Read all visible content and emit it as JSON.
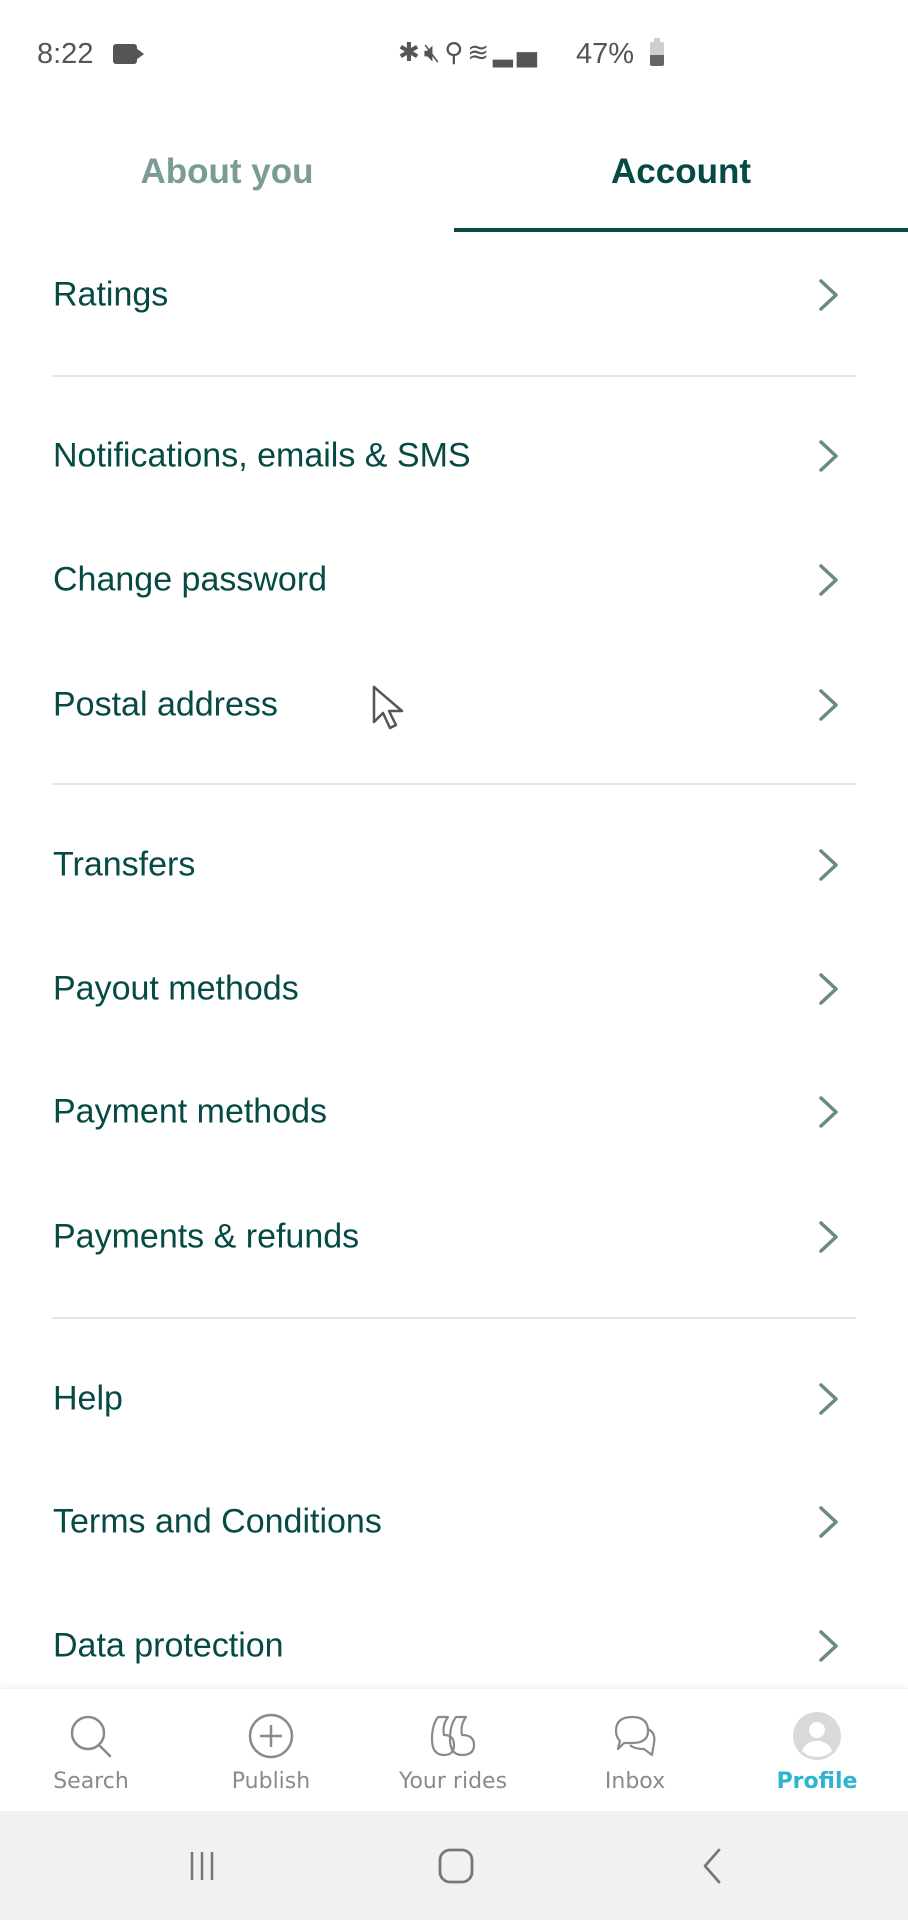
{
  "status_bar": {
    "time": "8:22",
    "recording_icon": "video-camera-icon",
    "indicator_icons": [
      "bluetooth-icon",
      "mute-vibrate-icon",
      "location-icon",
      "wifi-icon",
      "signal-icon"
    ],
    "battery_percent": "47%",
    "battery_level": 0.47
  },
  "tabs": [
    {
      "label": "About you",
      "active": false
    },
    {
      "label": "Account",
      "active": true
    }
  ],
  "colors": {
    "primary_text": "#054a44",
    "inactive_tab": "#7a9c95",
    "chevron": "#6b8a83",
    "active_nav": "#2eb4d0",
    "divider": "#e4e6e6"
  },
  "menu": {
    "items": [
      {
        "label": "Ratings",
        "icon": "chevron-right-icon"
      },
      {
        "label": "Notifications, emails & SMS",
        "icon": "chevron-right-icon"
      },
      {
        "label": "Change password",
        "icon": "chevron-right-icon"
      },
      {
        "label": "Postal address",
        "icon": "chevron-right-icon"
      },
      {
        "label": "Transfers",
        "icon": "chevron-right-icon"
      },
      {
        "label": "Payout methods",
        "icon": "chevron-right-icon"
      },
      {
        "label": "Payment methods",
        "icon": "chevron-right-icon"
      },
      {
        "label": "Payments & refunds",
        "icon": "chevron-right-icon"
      },
      {
        "label": "Help",
        "icon": "chevron-right-icon"
      },
      {
        "label": "Terms and Conditions",
        "icon": "chevron-right-icon"
      },
      {
        "label": "Data protection",
        "icon": "chevron-right-icon"
      }
    ]
  },
  "bottom_nav": {
    "items": [
      {
        "label": "Search",
        "icon": "search-icon",
        "active": false
      },
      {
        "label": "Publish",
        "icon": "plus-circle-icon",
        "active": false
      },
      {
        "label": "Your rides",
        "icon": "rides-icon",
        "active": false
      },
      {
        "label": "Inbox",
        "icon": "chat-bubbles-icon",
        "active": false
      },
      {
        "label": "Profile",
        "icon": "avatar-icon",
        "active": true
      }
    ]
  },
  "system_nav": {
    "buttons": [
      "recent-apps-icon",
      "home-icon",
      "back-icon"
    ]
  }
}
